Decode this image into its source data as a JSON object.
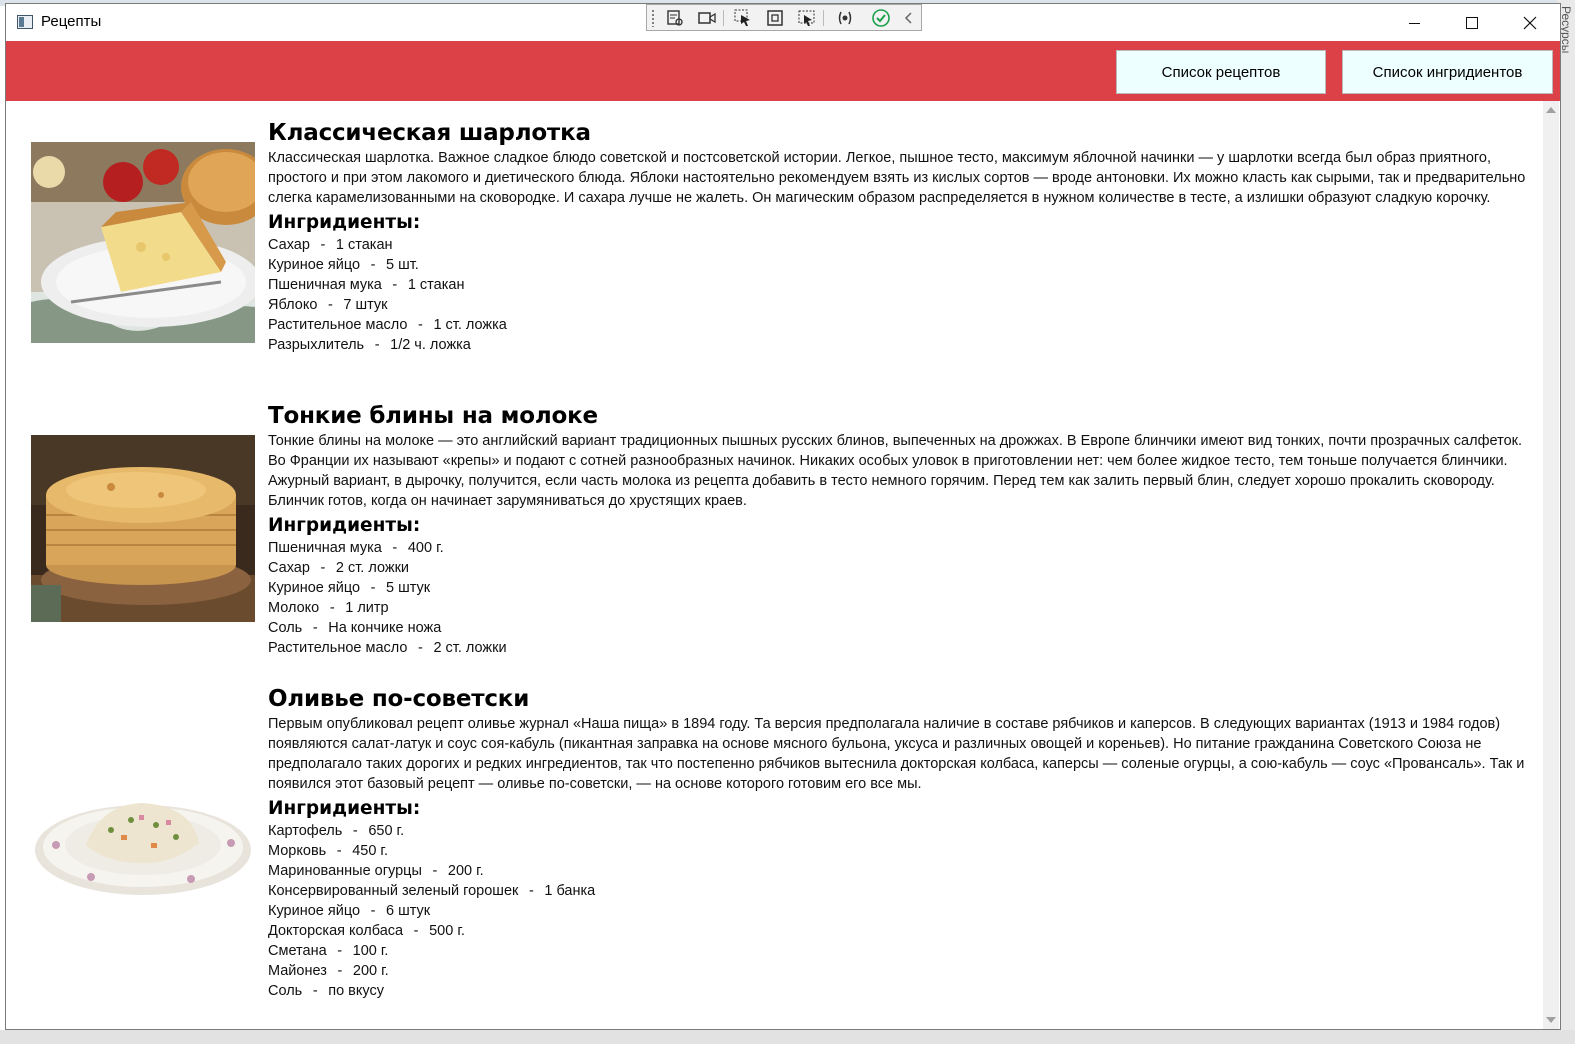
{
  "window": {
    "title": "Рецепты"
  },
  "nav": {
    "recipes_label": "Список рецептов",
    "ingredients_label": "Список ингридиентов"
  },
  "background": {
    "side_text": "Ресурсы"
  },
  "colors": {
    "header_bg": "#dc4147",
    "nav_button_bg": "#edfffe"
  },
  "ingredients_heading": "Ингридиенты:",
  "recipes": [
    {
      "title": "Классическая шарлотка",
      "image_icon": "apple-pie-photo",
      "description": "Классическая шарлотка. Важное сладкое блюдо советской и постсоветской истории. Легкое, пышное тесто, максимум яблочной начинки — у шарлотки всегда был образ приятного, простого и при этом лакомого и диетического блюда. Яблоки настоятельно рекомендуем взять из кислых сортов — вроде антоновки. Их можно класть как сырыми, так и предварительно слегка карамелизованными на сковородке. И сахара лучше не жалеть. Он магическим образом распределяется в нужном количестве в тесте, а излишки образуют сладкую корочку.",
      "ingredients": [
        {
          "name": "Сахар",
          "amount": "1 стакан"
        },
        {
          "name": "Куриное яйцо",
          "amount": "5 шт."
        },
        {
          "name": "Пшеничная мука",
          "amount": "1 стакан"
        },
        {
          "name": "Яблоко",
          "amount": "7 штук"
        },
        {
          "name": "Растительное масло",
          "amount": "1 ст. ложка"
        },
        {
          "name": "Разрыхлитель",
          "amount": "1/2 ч. ложка"
        }
      ]
    },
    {
      "title": "Тонкие блины на молоке",
      "image_icon": "pancakes-photo",
      "description": "Тонкие блины на молоке — это английский вариант традиционных пышных русских блинов, выпеченных на дрожжах. В Европе блинчики имеют вид тонких, почти прозрачных салфеток. Во Франции их называют «крепы» и подают с сотней разнообразных начинок. Никаких особых уловок в приготовлении нет: чем более жидкое тесто, тем тоньше получается блинчики. Ажурный вариант, в дырочку, получится, если часть молока из рецепта добавить в тесто немного горячим. Перед тем как залить первый блин, следует хорошо прокалить сковороду. Блинчик готов, когда он начинает зарумяниваться до хрустящих краев.",
      "ingredients": [
        {
          "name": "Пшеничная мука",
          "amount": "400 г."
        },
        {
          "name": "Сахар",
          "amount": "2 ст. ложки"
        },
        {
          "name": "Куриное яйцо",
          "amount": "5 штук"
        },
        {
          "name": "Молоко",
          "amount": "1 литр"
        },
        {
          "name": "Соль",
          "amount": "На кончике ножа"
        },
        {
          "name": "Растительное масло",
          "amount": "2 ст. ложки"
        }
      ]
    },
    {
      "title": "Оливье по-советски",
      "image_icon": "olivier-salad-photo",
      "description": "Первым опубликовал рецепт оливье журнал «Наша пища» в 1894 году. Та версия предполагала наличие в составе рябчиков и каперсов. В следующих вариантах (1913 и 1984 годов) появляются салат-латук и соус соя-кабуль (пикантная заправка на основе мясного бульона, уксуса и различных овощей и кореньев). Но питание гражданина Советского Союза не предполагало таких дорогих и редких ингредиентов, так что постепенно рябчиков вытеснила докторская колбаса, каперсы — соленые огурцы, а сою-кабуль — соус «Провансаль». Так и появился этот базовый рецепт — оливье по-советски, — на основе которого готовим его все мы.",
      "ingredients": [
        {
          "name": "Картофель",
          "amount": "650 г."
        },
        {
          "name": "Морковь",
          "amount": "450 г."
        },
        {
          "name": "Маринованные огурцы",
          "amount": "200 г."
        },
        {
          "name": "Консервированный зеленый горошек",
          "amount": "1 банка"
        },
        {
          "name": "Куриное яйцо",
          "amount": "6 штук"
        },
        {
          "name": "Докторская колбаса",
          "amount": "500 г."
        },
        {
          "name": "Сметана",
          "amount": "100 г."
        },
        {
          "name": "Майонез",
          "amount": "200 г."
        },
        {
          "name": "Соль",
          "amount": "по вкусу"
        }
      ]
    }
  ]
}
